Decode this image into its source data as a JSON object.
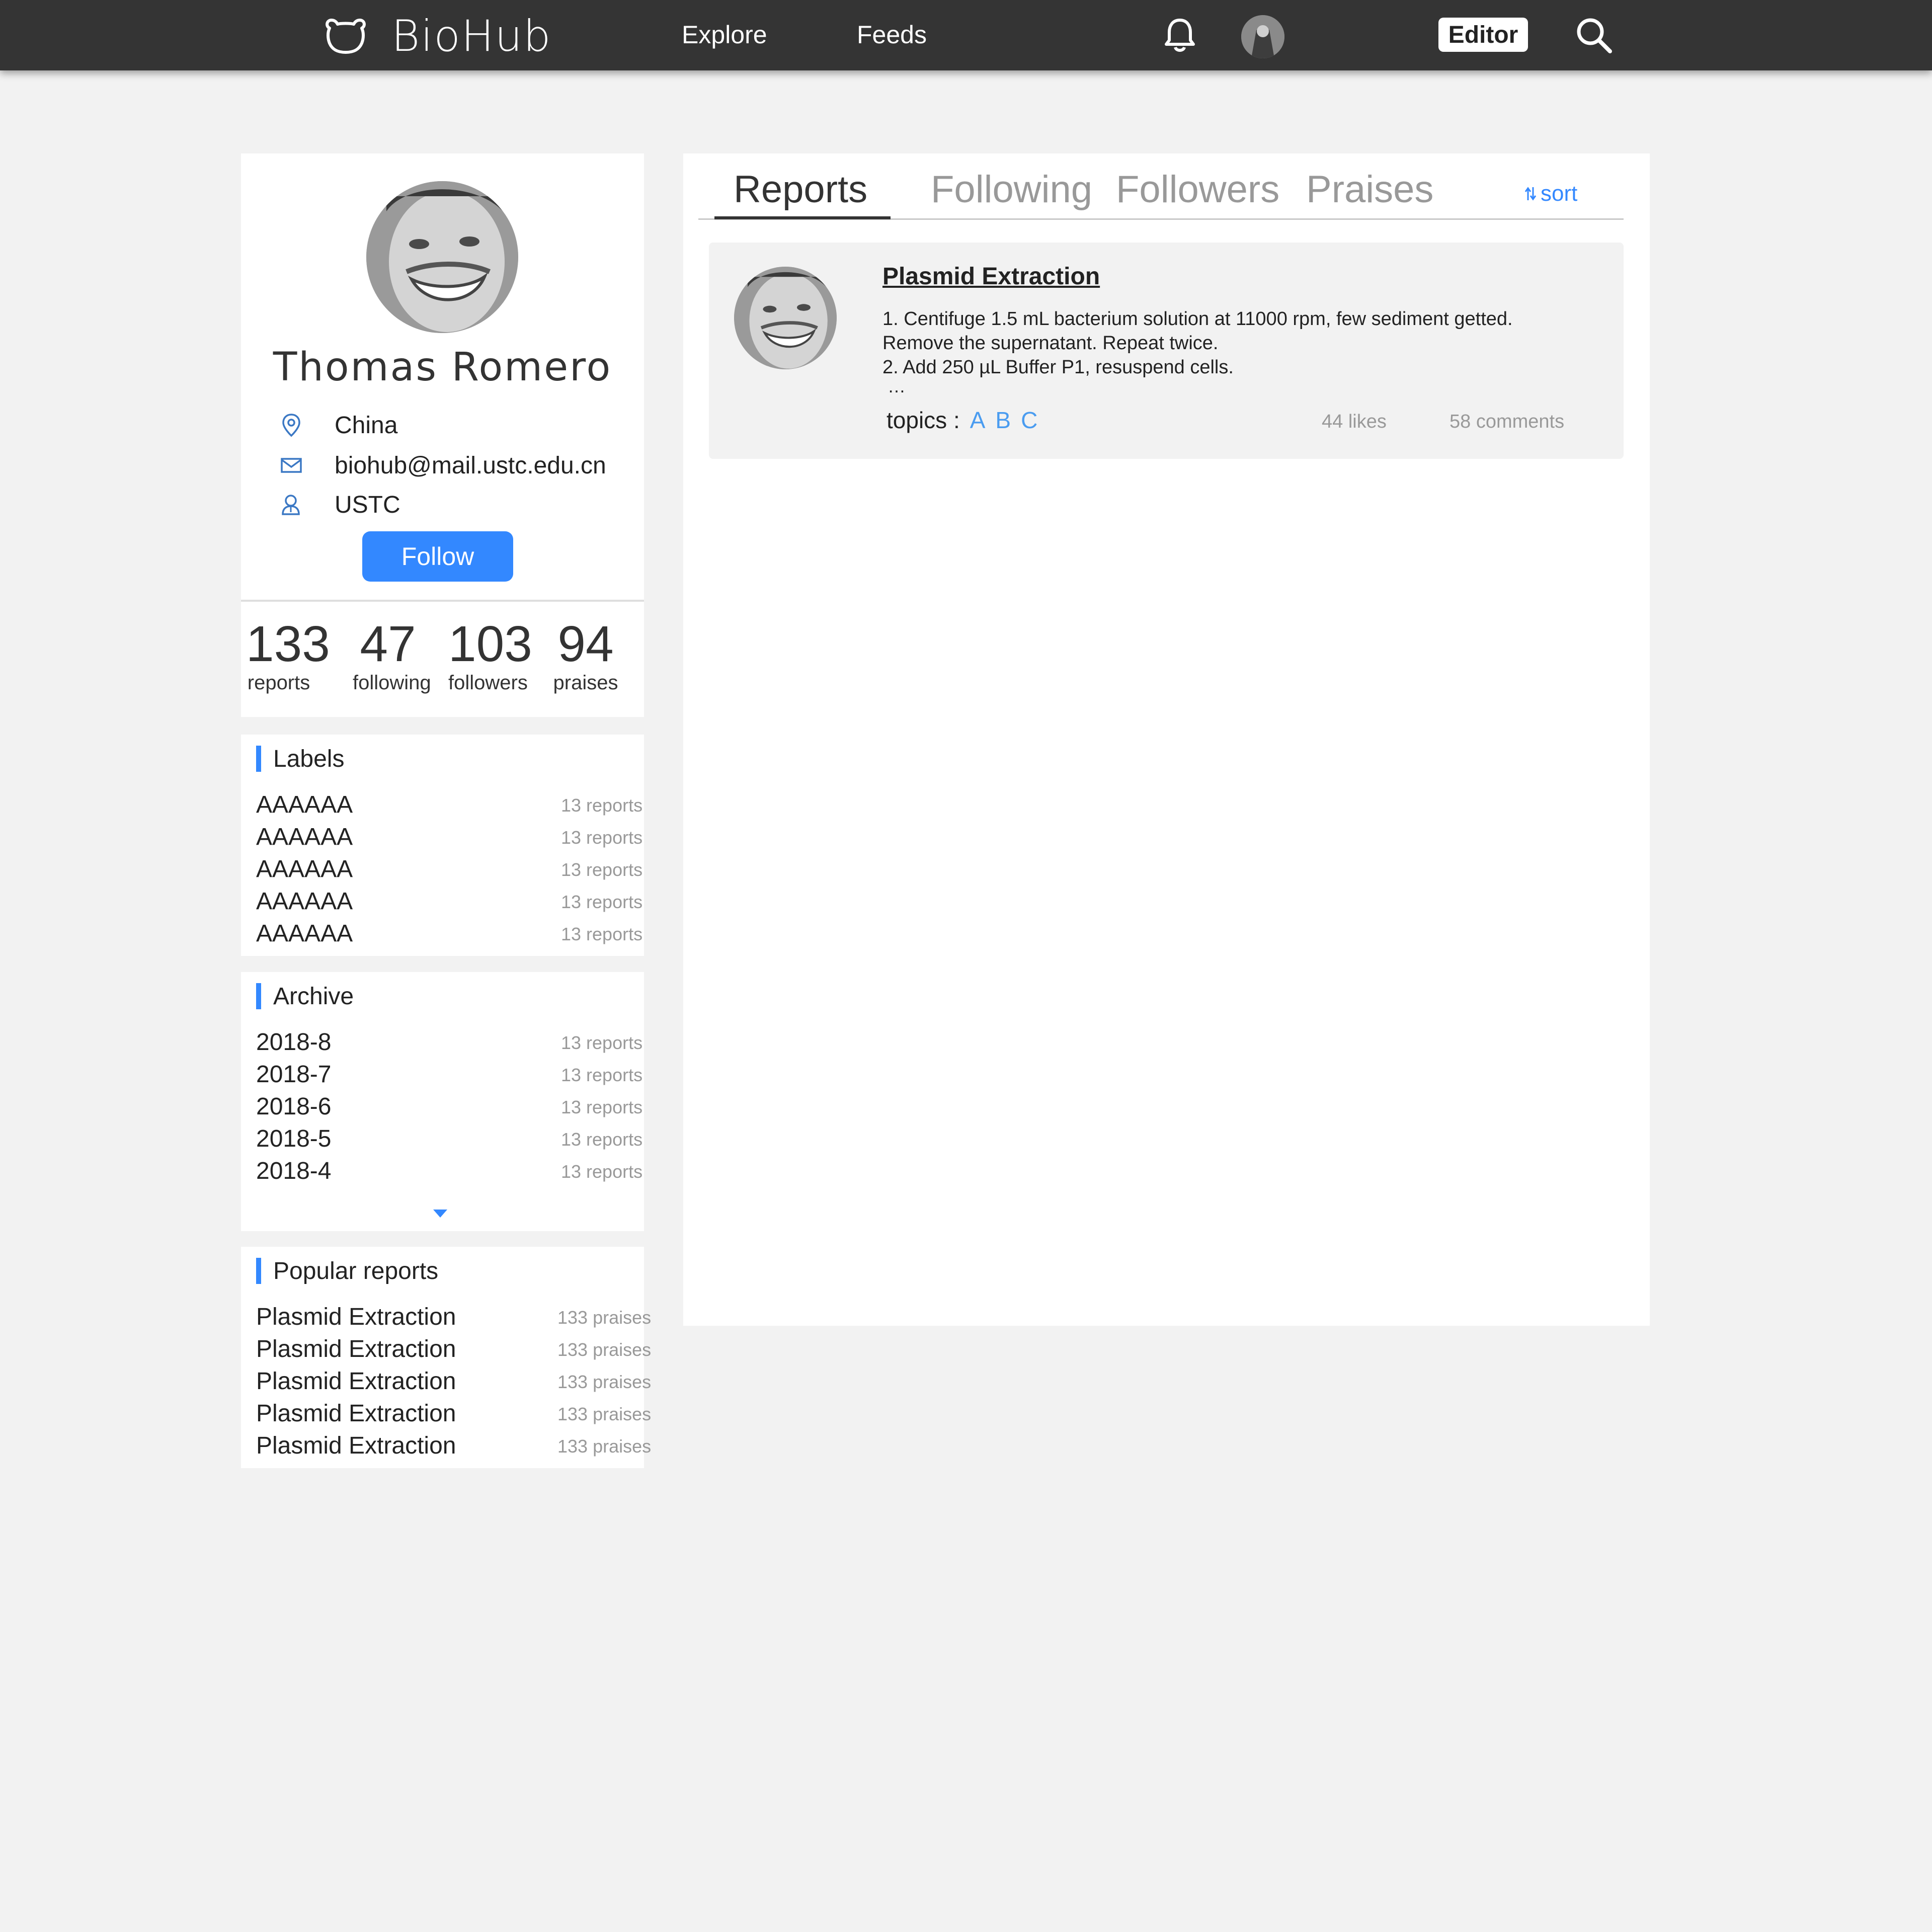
{
  "nav": {
    "brand": "BioHub",
    "links": [
      "Explore",
      "Feeds"
    ],
    "editor_label": "Editor"
  },
  "profile": {
    "name": "Thomas Romero",
    "location": "China",
    "email": "biohub@mail.ustc.edu.cn",
    "org": "USTC",
    "follow_label": "Follow",
    "stats": [
      {
        "num": "133",
        "label": "reports"
      },
      {
        "num": "47",
        "label": "following"
      },
      {
        "num": "103",
        "label": "followers"
      },
      {
        "num": "94",
        "label": "praises"
      }
    ]
  },
  "labels": {
    "title": "Labels",
    "items": [
      {
        "name": "AAAAAA",
        "count": "13 reports"
      },
      {
        "name": "AAAAAA",
        "count": "13 reports"
      },
      {
        "name": "AAAAAA",
        "count": "13 reports"
      },
      {
        "name": "AAAAAA",
        "count": "13 reports"
      },
      {
        "name": "AAAAAA",
        "count": "13 reports"
      }
    ]
  },
  "archive": {
    "title": "Archive",
    "items": [
      {
        "name": "2018-8",
        "count": "13 reports"
      },
      {
        "name": "2018-7",
        "count": "13 reports"
      },
      {
        "name": "2018-6",
        "count": "13 reports"
      },
      {
        "name": "2018-5",
        "count": "13 reports"
      },
      {
        "name": "2018-4",
        "count": "13 reports"
      }
    ]
  },
  "popular": {
    "title": "Popular reports",
    "items": [
      {
        "name": "Plasmid Extraction",
        "count": "133 praises"
      },
      {
        "name": "Plasmid Extraction",
        "count": "133 praises"
      },
      {
        "name": "Plasmid Extraction",
        "count": "133 praises"
      },
      {
        "name": "Plasmid Extraction",
        "count": "133 praises"
      },
      {
        "name": "Plasmid Extraction",
        "count": "133 praises"
      }
    ]
  },
  "tabs": [
    "Reports",
    "Following",
    "Followers",
    "Praises"
  ],
  "sort_label": "sort",
  "report": {
    "title": "Plasmid Extraction",
    "lines": [
      "1. Centifuge 1.5 mL bacterium solution at 11000 rpm, few sediment getted.",
      "Remove the supernatant. Repeat twice.",
      "2. Add 250 µL Buffer P1, resuspend cells."
    ],
    "ellipsis": "…",
    "topics_label": "topics :",
    "topics": [
      "A",
      "B",
      "C"
    ],
    "likes": "44 likes",
    "comments": "58 comments"
  },
  "colors": {
    "accent": "#3388ff",
    "nav_bg": "#343434",
    "page_bg": "#f2f2f2"
  }
}
